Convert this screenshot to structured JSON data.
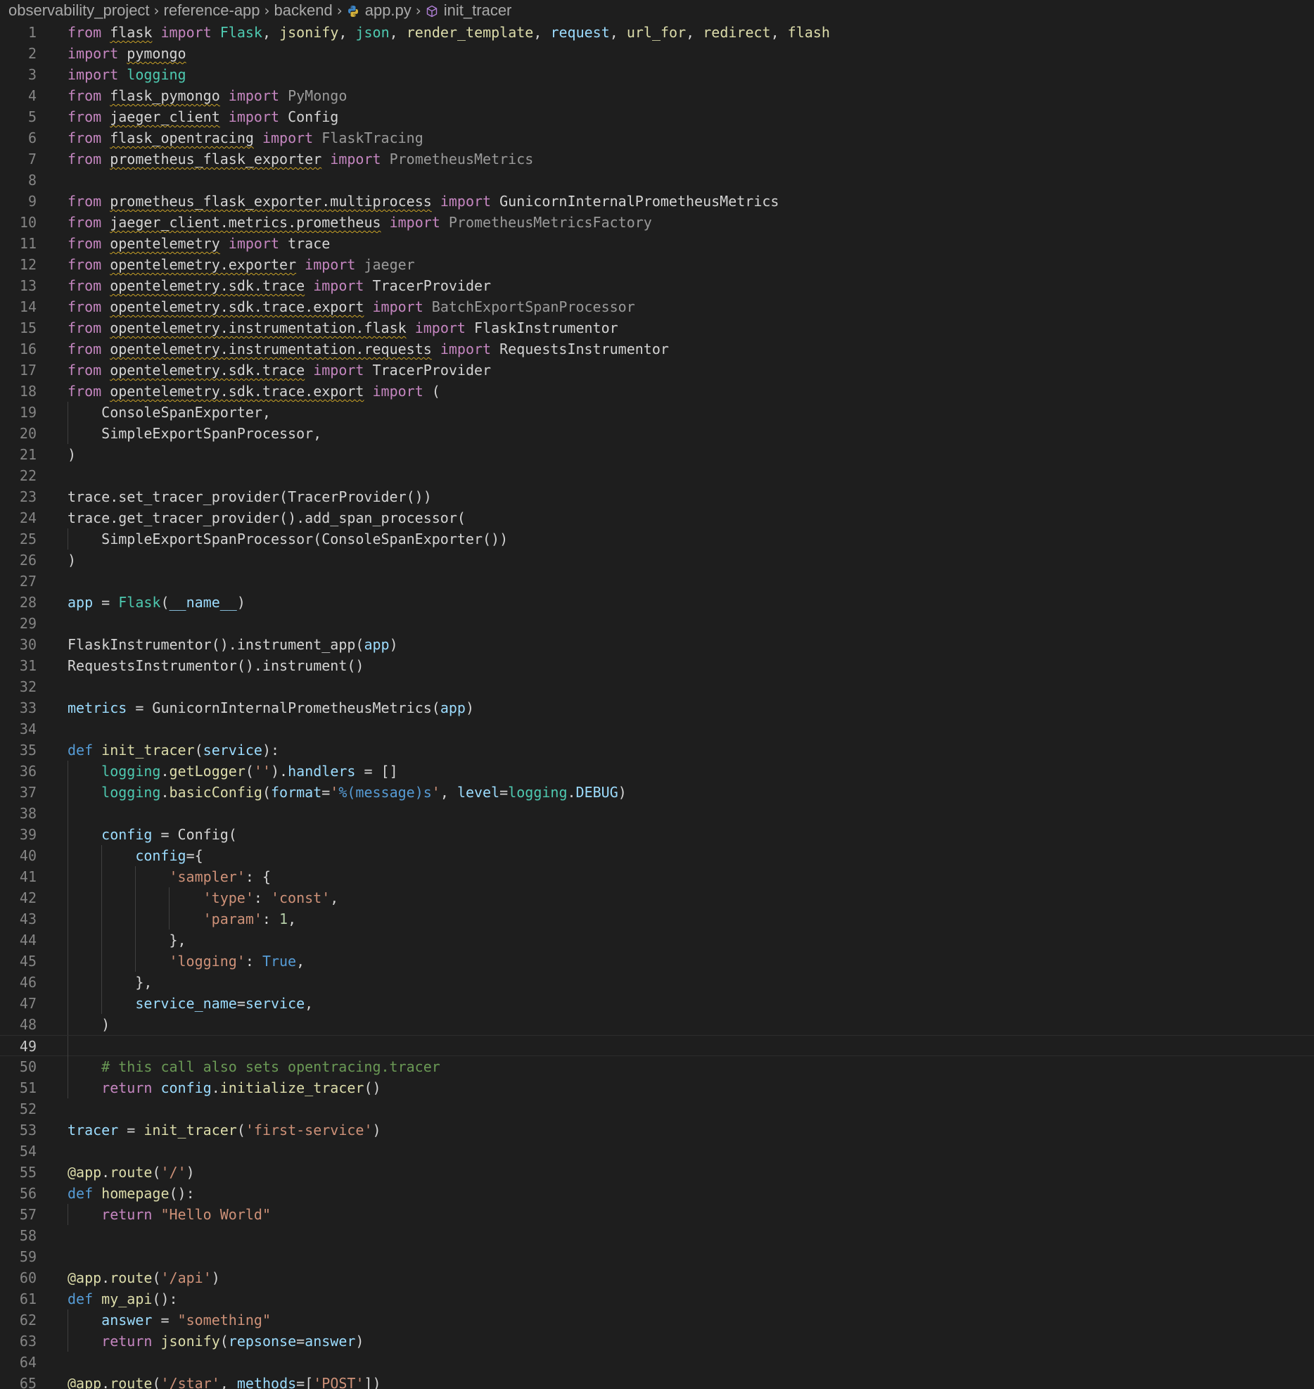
{
  "breadcrumb": {
    "items": [
      "observability_project",
      "reference-app",
      "backend",
      "app.py",
      "init_tracer"
    ],
    "separator": "›",
    "file_icon": "python-file-icon",
    "symbol_icon": "method-cube-icon"
  },
  "editor": {
    "language": "python",
    "current_line": 49,
    "colors": {
      "keyword": "#c586c0",
      "def": "#569cd6",
      "function": "#dcdcaa",
      "class": "#4ec9b0",
      "variable": "#9cdcfe",
      "string": "#ce9178",
      "number": "#b5cea8",
      "comment": "#6a9955",
      "warning_squiggle": "#c9a227"
    },
    "lines": [
      {
        "n": "1",
        "indent": 0,
        "tokens": [
          [
            "from ",
            "kw"
          ],
          [
            "flask",
            "cls-u"
          ],
          [
            " import ",
            "kw"
          ],
          [
            "Flask",
            "cls"
          ],
          [
            ", ",
            "op"
          ],
          [
            "jsonify",
            "fn"
          ],
          [
            ", ",
            "op"
          ],
          [
            "json",
            "cls"
          ],
          [
            ", ",
            "op"
          ],
          [
            "render_template",
            "fn"
          ],
          [
            ", ",
            "op"
          ],
          [
            "request",
            "var"
          ],
          [
            ", ",
            "op"
          ],
          [
            "url_for",
            "fn"
          ],
          [
            ", ",
            "op"
          ],
          [
            "redirect",
            "fn"
          ],
          [
            ", ",
            "op"
          ],
          [
            "flash",
            "fn"
          ]
        ]
      },
      {
        "n": "2",
        "indent": 0,
        "tokens": [
          [
            "import ",
            "kw"
          ],
          [
            "pymongo",
            "dim-u"
          ]
        ]
      },
      {
        "n": "3",
        "indent": 0,
        "tokens": [
          [
            "import ",
            "kw"
          ],
          [
            "logging",
            "cls"
          ]
        ]
      },
      {
        "n": "4",
        "indent": 0,
        "tokens": [
          [
            "from ",
            "kw"
          ],
          [
            "flask_pymongo",
            "mod-u"
          ],
          [
            " import ",
            "kw"
          ],
          [
            "PyMongo",
            "dim"
          ]
        ]
      },
      {
        "n": "5",
        "indent": 0,
        "tokens": [
          [
            "from ",
            "kw"
          ],
          [
            "jaeger_client",
            "mod-u"
          ],
          [
            " import ",
            "kw"
          ],
          [
            "Config",
            "mod"
          ]
        ]
      },
      {
        "n": "6",
        "indent": 0,
        "tokens": [
          [
            "from ",
            "kw"
          ],
          [
            "flask_opentracing",
            "mod-u"
          ],
          [
            " import ",
            "kw"
          ],
          [
            "FlaskTracing",
            "dim"
          ]
        ]
      },
      {
        "n": "7",
        "indent": 0,
        "tokens": [
          [
            "from ",
            "kw"
          ],
          [
            "prometheus_flask_exporter",
            "mod-u"
          ],
          [
            " import ",
            "kw"
          ],
          [
            "PrometheusMetrics",
            "dim"
          ]
        ]
      },
      {
        "n": "8",
        "indent": 0,
        "tokens": []
      },
      {
        "n": "9",
        "indent": 0,
        "tokens": [
          [
            "from ",
            "kw"
          ],
          [
            "prometheus_flask_exporter.multiprocess",
            "mod-u"
          ],
          [
            " import ",
            "kw"
          ],
          [
            "GunicornInternalPrometheusMetrics",
            "mod"
          ]
        ]
      },
      {
        "n": "10",
        "indent": 0,
        "tokens": [
          [
            "from ",
            "kw"
          ],
          [
            "jaeger_client.metrics.prometheus",
            "mod-u"
          ],
          [
            " import ",
            "kw"
          ],
          [
            "PrometheusMetricsFactory",
            "dim"
          ]
        ]
      },
      {
        "n": "11",
        "indent": 0,
        "tokens": [
          [
            "from ",
            "kw"
          ],
          [
            "opentelemetry",
            "mod-u"
          ],
          [
            " import ",
            "kw"
          ],
          [
            "trace",
            "mod"
          ]
        ]
      },
      {
        "n": "12",
        "indent": 0,
        "tokens": [
          [
            "from ",
            "kw"
          ],
          [
            "opentelemetry.exporter",
            "mod-u"
          ],
          [
            " import ",
            "kw"
          ],
          [
            "jaeger",
            "dim"
          ]
        ]
      },
      {
        "n": "13",
        "indent": 0,
        "tokens": [
          [
            "from ",
            "kw"
          ],
          [
            "opentelemetry.sdk.trace",
            "mod-u"
          ],
          [
            " import ",
            "kw"
          ],
          [
            "TracerProvider",
            "mod"
          ]
        ]
      },
      {
        "n": "14",
        "indent": 0,
        "tokens": [
          [
            "from ",
            "kw"
          ],
          [
            "opentelemetry.sdk.trace.export",
            "mod-u"
          ],
          [
            " import ",
            "kw"
          ],
          [
            "BatchExportSpanProcessor",
            "dim"
          ]
        ]
      },
      {
        "n": "15",
        "indent": 0,
        "tokens": [
          [
            "from ",
            "kw"
          ],
          [
            "opentelemetry.instrumentation.flask",
            "mod-u"
          ],
          [
            " import ",
            "kw"
          ],
          [
            "FlaskInstrumentor",
            "mod"
          ]
        ]
      },
      {
        "n": "16",
        "indent": 0,
        "tokens": [
          [
            "from ",
            "kw"
          ],
          [
            "opentelemetry.instrumentation.requests",
            "mod-u"
          ],
          [
            " import ",
            "kw"
          ],
          [
            "RequestsInstrumentor",
            "mod"
          ]
        ]
      },
      {
        "n": "17",
        "indent": 0,
        "tokens": [
          [
            "from ",
            "kw"
          ],
          [
            "opentelemetry.sdk.trace",
            "mod-u"
          ],
          [
            " import ",
            "kw"
          ],
          [
            "TracerProvider",
            "mod"
          ]
        ]
      },
      {
        "n": "18",
        "indent": 0,
        "tokens": [
          [
            "from ",
            "kw"
          ],
          [
            "opentelemetry.sdk.trace.export",
            "mod-u"
          ],
          [
            " import ",
            "kw"
          ],
          [
            "(",
            "op"
          ]
        ]
      },
      {
        "n": "19",
        "indent": 1,
        "tokens": [
          [
            "ConsoleSpanExporter,",
            "mod"
          ]
        ]
      },
      {
        "n": "20",
        "indent": 1,
        "tokens": [
          [
            "SimpleExportSpanProcessor,",
            "mod"
          ]
        ]
      },
      {
        "n": "21",
        "indent": 0,
        "tokens": [
          [
            ")",
            "op"
          ]
        ]
      },
      {
        "n": "22",
        "indent": 0,
        "tokens": []
      },
      {
        "n": "23",
        "indent": 0,
        "tokens": [
          [
            "trace.set_tracer_provider(TracerProvider())",
            "mod"
          ]
        ]
      },
      {
        "n": "24",
        "indent": 0,
        "tokens": [
          [
            "trace.get_tracer_provider().add_span_processor(",
            "mod"
          ]
        ]
      },
      {
        "n": "25",
        "indent": 1,
        "tokens": [
          [
            "SimpleExportSpanProcessor(ConsoleSpanExporter())",
            "mod"
          ]
        ]
      },
      {
        "n": "26",
        "indent": 0,
        "tokens": [
          [
            ")",
            "op"
          ]
        ]
      },
      {
        "n": "27",
        "indent": 0,
        "tokens": []
      },
      {
        "n": "28",
        "indent": 0,
        "tokens": [
          [
            "app",
            "var"
          ],
          [
            " = ",
            "op"
          ],
          [
            "Flask",
            "cls"
          ],
          [
            "(",
            "op"
          ],
          [
            "__name__",
            "var"
          ],
          [
            ")",
            "op"
          ]
        ]
      },
      {
        "n": "29",
        "indent": 0,
        "tokens": []
      },
      {
        "n": "30",
        "indent": 0,
        "tokens": [
          [
            "FlaskInstrumentor().instrument_app(",
            "mod"
          ],
          [
            "app",
            "var"
          ],
          [
            ")",
            "op"
          ]
        ]
      },
      {
        "n": "31",
        "indent": 0,
        "tokens": [
          [
            "RequestsInstrumentor().instrument()",
            "mod"
          ]
        ]
      },
      {
        "n": "32",
        "indent": 0,
        "tokens": []
      },
      {
        "n": "33",
        "indent": 0,
        "tokens": [
          [
            "metrics",
            "var"
          ],
          [
            " = ",
            "op"
          ],
          [
            "GunicornInternalPrometheusMetrics(",
            "mod"
          ],
          [
            "app",
            "var"
          ],
          [
            ")",
            "op"
          ]
        ]
      },
      {
        "n": "34",
        "indent": 0,
        "tokens": []
      },
      {
        "n": "35",
        "indent": 0,
        "tokens": [
          [
            "def ",
            "def"
          ],
          [
            "init_tracer",
            "fn"
          ],
          [
            "(",
            "op"
          ],
          [
            "service",
            "var"
          ],
          [
            "):",
            "op"
          ]
        ]
      },
      {
        "n": "36",
        "indent": 1,
        "tokens": [
          [
            "logging",
            "cls"
          ],
          [
            ".",
            "op"
          ],
          [
            "getLogger",
            "fn"
          ],
          [
            "(",
            "op"
          ],
          [
            "''",
            "str"
          ],
          [
            ").",
            "op"
          ],
          [
            "handlers",
            "var"
          ],
          [
            " = []",
            "op"
          ]
        ]
      },
      {
        "n": "37",
        "indent": 1,
        "tokens": [
          [
            "logging",
            "cls"
          ],
          [
            ".",
            "op"
          ],
          [
            "basicConfig",
            "fn"
          ],
          [
            "(",
            "op"
          ],
          [
            "format",
            "var"
          ],
          [
            "=",
            "op"
          ],
          [
            "'",
            "str"
          ],
          [
            "%(message)s",
            "def"
          ],
          [
            "'",
            "str"
          ],
          [
            ", ",
            "op"
          ],
          [
            "level",
            "var"
          ],
          [
            "=",
            "op"
          ],
          [
            "logging",
            "cls"
          ],
          [
            ".",
            "op"
          ],
          [
            "DEBUG",
            "var"
          ],
          [
            ")",
            "op"
          ]
        ]
      },
      {
        "n": "38",
        "indent": 1,
        "tokens": []
      },
      {
        "n": "39",
        "indent": 1,
        "tokens": [
          [
            "config",
            "var"
          ],
          [
            " = ",
            "op"
          ],
          [
            "Config(",
            "mod"
          ]
        ]
      },
      {
        "n": "40",
        "indent": 2,
        "tokens": [
          [
            "config",
            "var"
          ],
          [
            "={",
            "op"
          ]
        ]
      },
      {
        "n": "41",
        "indent": 3,
        "tokens": [
          [
            "'sampler'",
            "str"
          ],
          [
            ": {",
            "op"
          ]
        ]
      },
      {
        "n": "42",
        "indent": 4,
        "tokens": [
          [
            "'type'",
            "str"
          ],
          [
            ": ",
            "op"
          ],
          [
            "'const'",
            "str"
          ],
          [
            ",",
            "op"
          ]
        ]
      },
      {
        "n": "43",
        "indent": 4,
        "tokens": [
          [
            "'param'",
            "str"
          ],
          [
            ": ",
            "op"
          ],
          [
            "1",
            "num"
          ],
          [
            ",",
            "op"
          ]
        ]
      },
      {
        "n": "44",
        "indent": 3,
        "tokens": [
          [
            "},",
            "op"
          ]
        ]
      },
      {
        "n": "45",
        "indent": 3,
        "tokens": [
          [
            "'logging'",
            "str"
          ],
          [
            ": ",
            "op"
          ],
          [
            "True",
            "def"
          ],
          [
            ",",
            "op"
          ]
        ]
      },
      {
        "n": "46",
        "indent": 2,
        "tokens": [
          [
            "},",
            "op"
          ]
        ]
      },
      {
        "n": "47",
        "indent": 2,
        "tokens": [
          [
            "service_name",
            "var"
          ],
          [
            "=",
            "op"
          ],
          [
            "service",
            "var"
          ],
          [
            ",",
            "op"
          ]
        ]
      },
      {
        "n": "48",
        "indent": 1,
        "tokens": [
          [
            ")",
            "op"
          ]
        ]
      },
      {
        "n": "49",
        "indent": 1,
        "tokens": []
      },
      {
        "n": "50",
        "indent": 1,
        "tokens": [
          [
            "# this call also sets opentracing.tracer",
            "cm"
          ]
        ]
      },
      {
        "n": "51",
        "indent": 1,
        "tokens": [
          [
            "return ",
            "kw"
          ],
          [
            "config",
            "var"
          ],
          [
            ".",
            "op"
          ],
          [
            "initialize_tracer",
            "fn"
          ],
          [
            "()",
            "op"
          ]
        ]
      },
      {
        "n": "52",
        "indent": 0,
        "tokens": []
      },
      {
        "n": "53",
        "indent": 0,
        "tokens": [
          [
            "tracer",
            "var"
          ],
          [
            " = ",
            "op"
          ],
          [
            "init_tracer",
            "fn"
          ],
          [
            "(",
            "op"
          ],
          [
            "'first-service'",
            "str"
          ],
          [
            ")",
            "op"
          ]
        ]
      },
      {
        "n": "54",
        "indent": 0,
        "tokens": []
      },
      {
        "n": "55",
        "indent": 0,
        "tokens": [
          [
            "@app",
            "fn"
          ],
          [
            ".",
            "op"
          ],
          [
            "route",
            "fn"
          ],
          [
            "(",
            "op"
          ],
          [
            "'/'",
            "str"
          ],
          [
            ")",
            "op"
          ]
        ]
      },
      {
        "n": "56",
        "indent": 0,
        "tokens": [
          [
            "def ",
            "def"
          ],
          [
            "homepage",
            "fn"
          ],
          [
            "():",
            "op"
          ]
        ]
      },
      {
        "n": "57",
        "indent": 1,
        "tokens": [
          [
            "return ",
            "kw"
          ],
          [
            "\"Hello World\"",
            "str"
          ]
        ]
      },
      {
        "n": "58",
        "indent": 0,
        "tokens": []
      },
      {
        "n": "59",
        "indent": 0,
        "tokens": []
      },
      {
        "n": "60",
        "indent": 0,
        "tokens": [
          [
            "@app",
            "fn"
          ],
          [
            ".",
            "op"
          ],
          [
            "route",
            "fn"
          ],
          [
            "(",
            "op"
          ],
          [
            "'/api'",
            "str"
          ],
          [
            ")",
            "op"
          ]
        ]
      },
      {
        "n": "61",
        "indent": 0,
        "tokens": [
          [
            "def ",
            "def"
          ],
          [
            "my_api",
            "fn"
          ],
          [
            "():",
            "op"
          ]
        ]
      },
      {
        "n": "62",
        "indent": 1,
        "tokens": [
          [
            "answer",
            "var"
          ],
          [
            " = ",
            "op"
          ],
          [
            "\"something\"",
            "str"
          ]
        ]
      },
      {
        "n": "63",
        "indent": 1,
        "tokens": [
          [
            "return ",
            "kw"
          ],
          [
            "jsonify",
            "fn"
          ],
          [
            "(",
            "op"
          ],
          [
            "repsonse",
            "var"
          ],
          [
            "=",
            "op"
          ],
          [
            "answer",
            "var"
          ],
          [
            ")",
            "op"
          ]
        ]
      },
      {
        "n": "64",
        "indent": 0,
        "tokens": []
      },
      {
        "n": "65",
        "indent": 0,
        "tokens": [
          [
            "@app",
            "fn"
          ],
          [
            ".",
            "op"
          ],
          [
            "route",
            "fn"
          ],
          [
            "(",
            "op"
          ],
          [
            "'/star'",
            "str"
          ],
          [
            ", ",
            "op"
          ],
          [
            "methods",
            "var"
          ],
          [
            "=[",
            "op"
          ],
          [
            "'POST'",
            "str"
          ],
          [
            "])",
            "op"
          ]
        ]
      }
    ]
  }
}
